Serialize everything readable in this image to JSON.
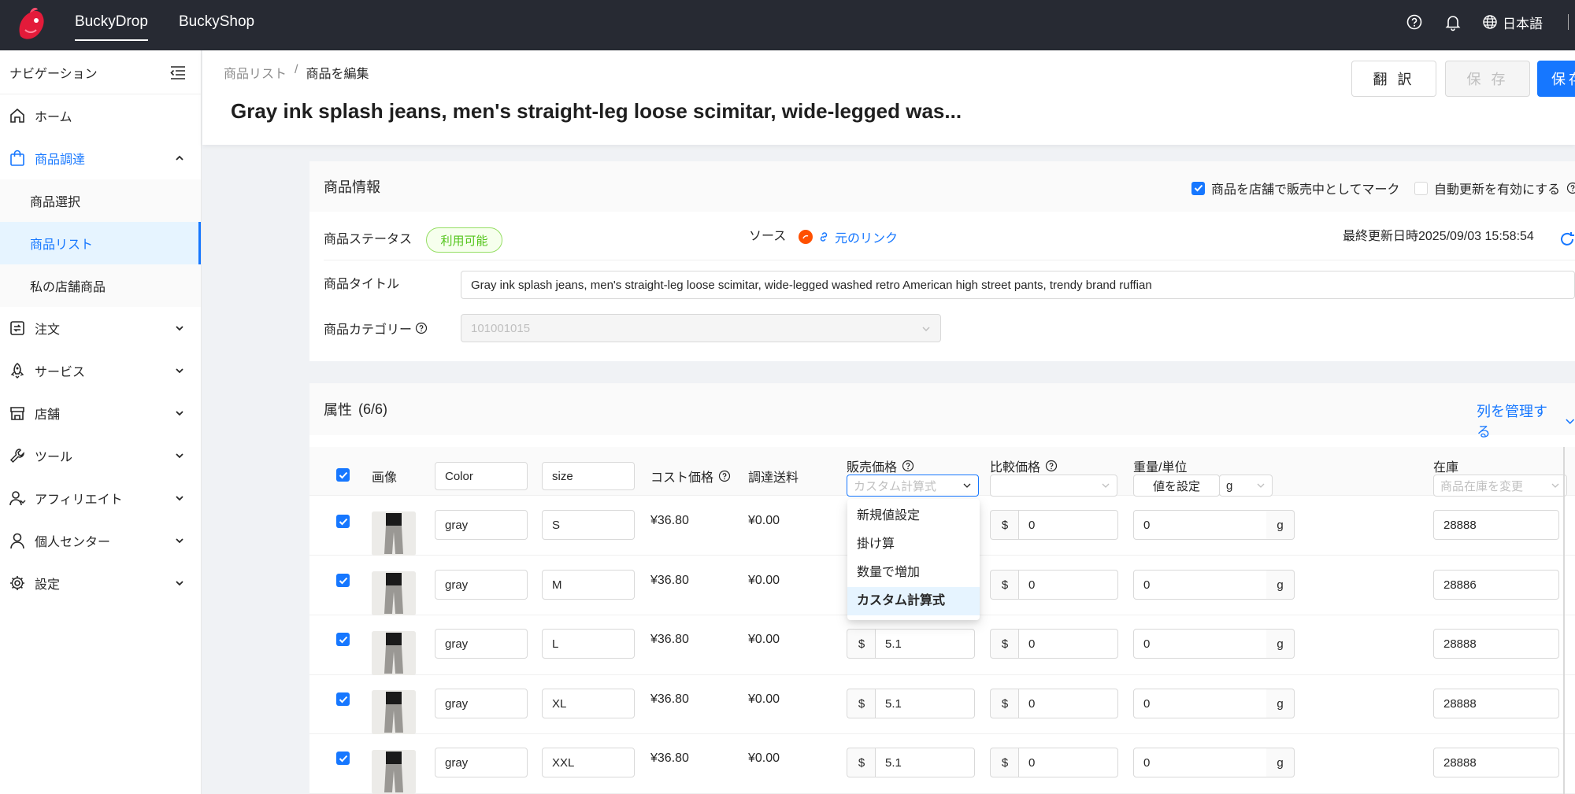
{
  "topbar": {
    "tabs": [
      {
        "label": "BuckyDrop"
      },
      {
        "label": "BuckyShop"
      }
    ],
    "language": "日本語"
  },
  "sidebar": {
    "header": "ナビゲーション",
    "items": [
      {
        "label": "ホーム"
      },
      {
        "label": "商品調達"
      },
      {
        "label": "注文"
      },
      {
        "label": "サービス"
      },
      {
        "label": "店舗"
      },
      {
        "label": "ツール"
      },
      {
        "label": "アフィリエイト"
      },
      {
        "label": "個人センター"
      },
      {
        "label": "設定"
      }
    ],
    "sub_items": [
      {
        "label": "商品選択"
      },
      {
        "label": "商品リスト"
      },
      {
        "label": "私の店舗商品"
      }
    ]
  },
  "header": {
    "breadcrumb": [
      "商品リスト",
      "/",
      "商品を編集"
    ],
    "title": "Gray ink splash jeans, men's straight-leg loose scimitar, wide-legged was...",
    "translate_label": "翻 訳",
    "save_disabled_label": "保 存",
    "save_label": "保存"
  },
  "product_info": {
    "section_title": "商品情報",
    "mark_on_sale_label": "商品を店舗で販売中としてマーク",
    "mark_on_sale_checked": true,
    "auto_update_label": "自動更新を有効にする",
    "auto_update_checked": false,
    "status_label": "商品ステータス",
    "status_value": "利用可能",
    "source_label": "ソース",
    "source_link": "元のリンク",
    "last_updated": "最終更新日時2025/09/03 15:58:54",
    "title_label": "商品タイトル",
    "title_value": "Gray ink splash jeans, men's straight-leg loose scimitar, wide-legged washed retro American high street pants, trendy brand ruffian",
    "category_label": "商品カテゴリー",
    "category_value": "101001015"
  },
  "attributes": {
    "section_title": "属性",
    "count": "(6/6)",
    "manage_columns": "列を管理する",
    "headers": {
      "image": "画像",
      "color": "Color",
      "size": "size",
      "cost": "コスト価格",
      "shipping": "調達送料",
      "sale_price": "販売価格",
      "sale_price_placeholder": "カスタム計算式",
      "compare_price": "比較価格",
      "weight": "重量/単位",
      "weight_set": "値を設定",
      "weight_unit": "g",
      "stock": "在庫",
      "stock_placeholder": "商品在庫を変更"
    },
    "rows": [
      {
        "color": "gray",
        "size": "S",
        "cost": "¥36.80",
        "shipping": "¥0.00",
        "sale_price": "",
        "compare": "0",
        "weight": "0",
        "stock": "28888"
      },
      {
        "color": "gray",
        "size": "M",
        "cost": "¥36.80",
        "shipping": "¥0.00",
        "sale_price": "",
        "compare": "0",
        "weight": "0",
        "stock": "28886"
      },
      {
        "color": "gray",
        "size": "L",
        "cost": "¥36.80",
        "shipping": "¥0.00",
        "sale_price": "5.1",
        "compare": "0",
        "weight": "0",
        "stock": "28888"
      },
      {
        "color": "gray",
        "size": "XL",
        "cost": "¥36.80",
        "shipping": "¥0.00",
        "sale_price": "5.1",
        "compare": "0",
        "weight": "0",
        "stock": "28888"
      },
      {
        "color": "gray",
        "size": "XXL",
        "cost": "¥36.80",
        "shipping": "¥0.00",
        "sale_price": "5.1",
        "compare": "0",
        "weight": "0",
        "stock": "28888"
      }
    ],
    "currency": "$",
    "unit_g": "g"
  },
  "dropdown": {
    "options": [
      "新規値設定",
      "掛け算",
      "数量で増加",
      "カスタム計算式"
    ],
    "selected": "カスタム計算式"
  },
  "colors": {
    "accent": "#1677ff",
    "topbar": "#272a33",
    "success": "#52c41a"
  }
}
